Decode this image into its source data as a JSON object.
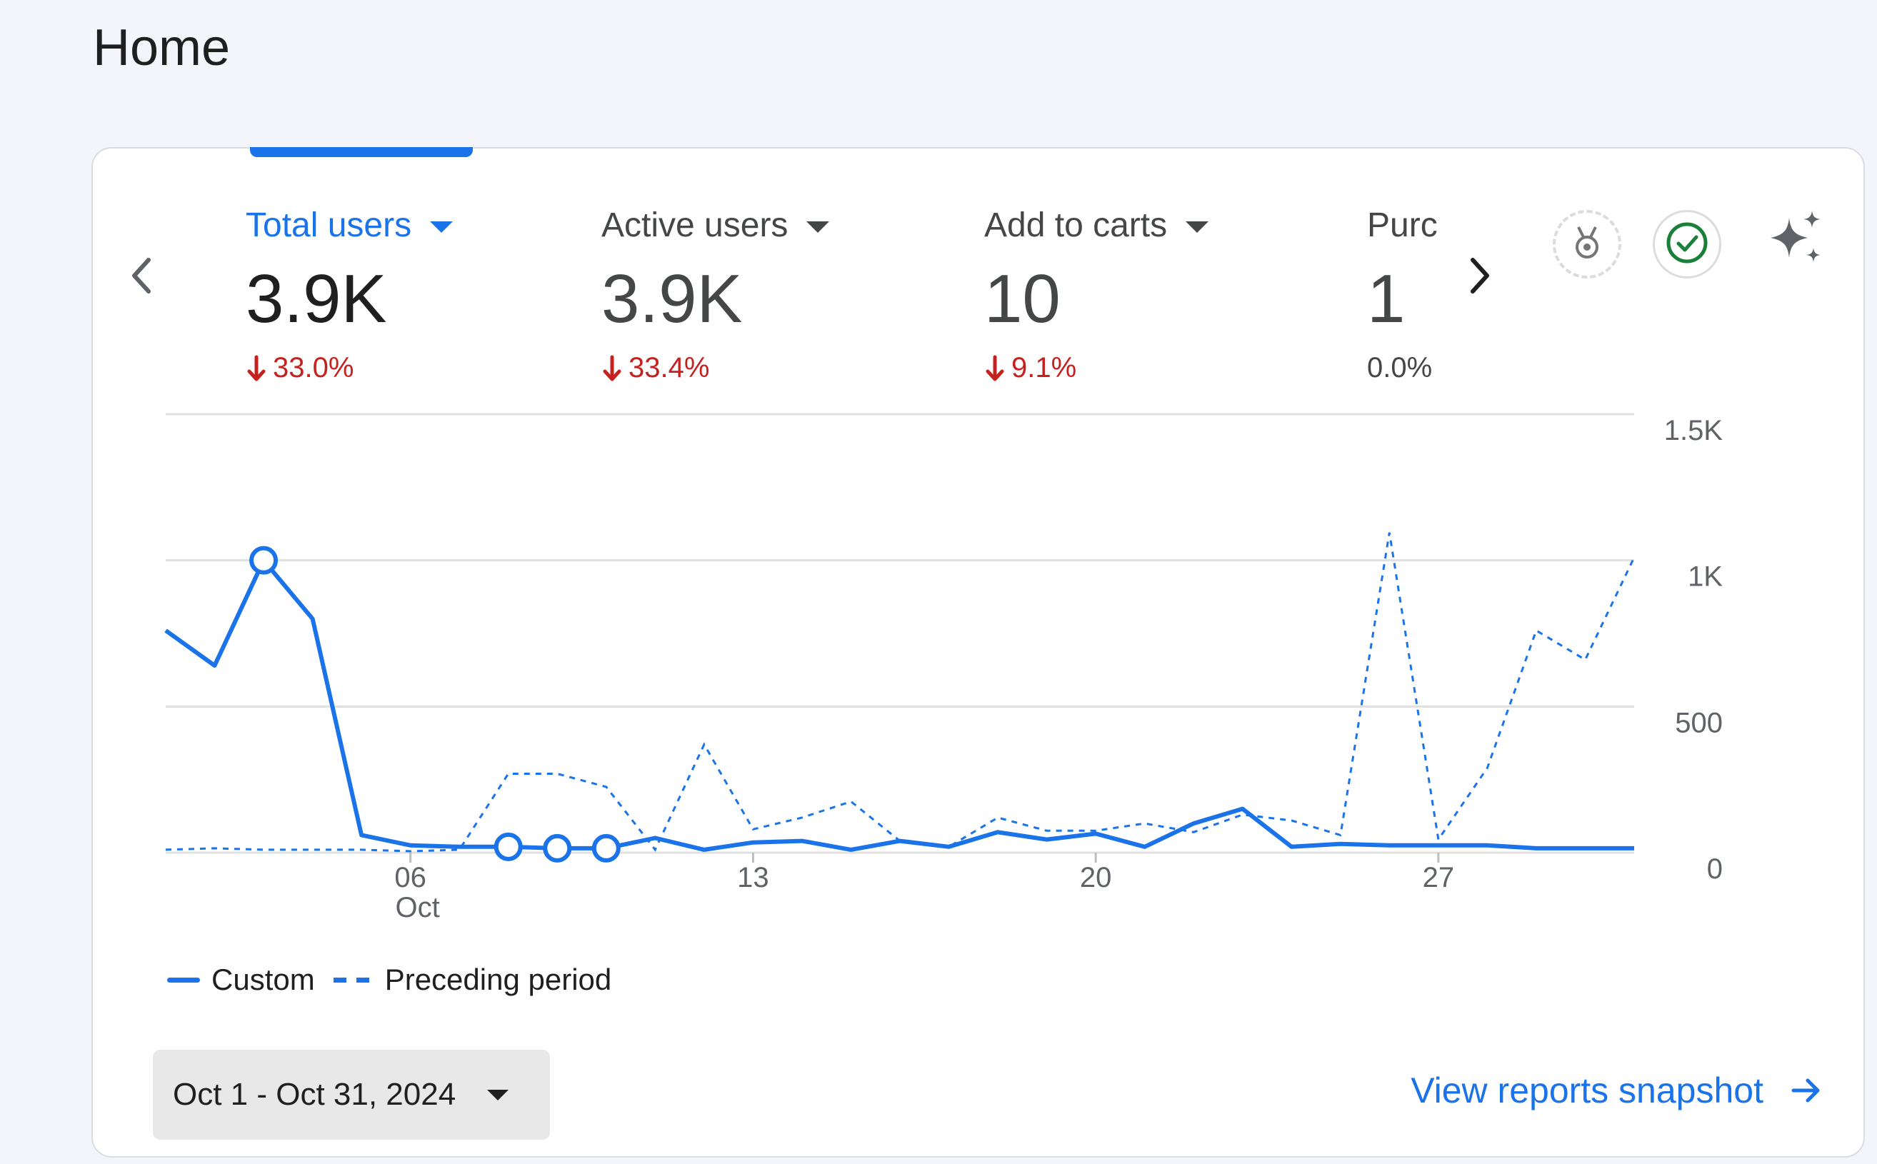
{
  "page": {
    "title": "Home"
  },
  "metrics": [
    {
      "label": "Total users",
      "value": "3.9K",
      "change": "33.0%",
      "direction": "down",
      "active": true
    },
    {
      "label": "Active users",
      "value": "3.9K",
      "change": "33.4%",
      "direction": "down",
      "active": false
    },
    {
      "label": "Add to carts",
      "value": "10",
      "change": "9.1%",
      "direction": "down",
      "active": false
    },
    {
      "label": "Purc",
      "value": "1",
      "change": "0.0%",
      "direction": "none",
      "active": false
    }
  ],
  "icons": {
    "prev": "chevron-left-icon",
    "next": "chevron-right-icon",
    "badge": "medal-icon",
    "check": "check-circle-icon",
    "insights": "sparkle-icon"
  },
  "colors": {
    "accent": "#1a73e8",
    "negative": "#c5221f",
    "check": "#188038"
  },
  "chart_data": {
    "type": "line",
    "x": [
      1,
      2,
      3,
      4,
      5,
      6,
      7,
      8,
      9,
      10,
      11,
      12,
      13,
      14,
      15,
      16,
      17,
      18,
      19,
      20,
      21,
      22,
      23,
      24,
      25,
      26,
      27,
      28,
      29,
      30,
      31
    ],
    "x_ticks": [
      {
        "day": 6,
        "label": "06",
        "sublabel": "Oct"
      },
      {
        "day": 13,
        "label": "13",
        "sublabel": ""
      },
      {
        "day": 20,
        "label": "20",
        "sublabel": ""
      },
      {
        "day": 27,
        "label": "27",
        "sublabel": ""
      }
    ],
    "y_ticks": [
      {
        "value": 0,
        "label": "0"
      },
      {
        "value": 500,
        "label": "500"
      },
      {
        "value": 1000,
        "label": "1K"
      },
      {
        "value": 1500,
        "label": "1.5K"
      }
    ],
    "ylim": [
      0,
      1500
    ],
    "grid": true,
    "legend_position": "bottom-left",
    "series": [
      {
        "name": "Custom",
        "style": "solid",
        "values": [
          760,
          640,
          1000,
          800,
          60,
          25,
          20,
          20,
          15,
          15,
          50,
          10,
          35,
          40,
          10,
          40,
          20,
          70,
          45,
          65,
          20,
          100,
          150,
          20,
          30,
          25,
          25,
          25,
          15,
          15,
          15
        ],
        "markers": [
          3,
          8,
          9,
          10
        ]
      },
      {
        "name": "Preceding period",
        "style": "dashed",
        "values": [
          10,
          15,
          10,
          10,
          10,
          5,
          10,
          270,
          270,
          225,
          10,
          370,
          80,
          120,
          175,
          40,
          20,
          120,
          75,
          75,
          100,
          70,
          130,
          110,
          60,
          1095,
          45,
          290,
          760,
          660,
          1010
        ]
      }
    ]
  },
  "legend": {
    "custom": "Custom",
    "preceding": "Preceding period"
  },
  "date_range": {
    "label": "Oct 1 - Oct 31, 2024"
  },
  "footer": {
    "view_reports": "View reports snapshot"
  }
}
